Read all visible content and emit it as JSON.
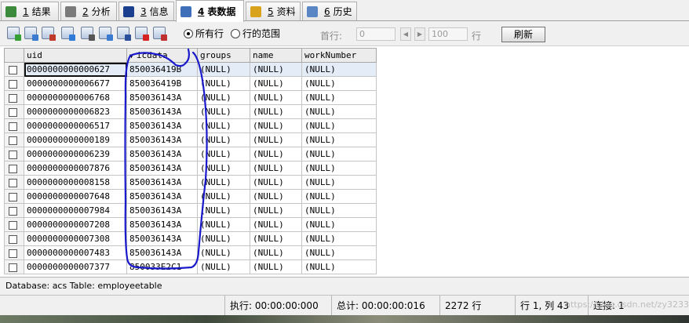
{
  "tabs": [
    {
      "num": "1",
      "label": "结果",
      "icon": "results-icon",
      "color": "#3c8a3c",
      "active": false
    },
    {
      "num": "2",
      "label": "分析",
      "icon": "profiler-icon",
      "color": "#7a7a7a",
      "active": false
    },
    {
      "num": "3",
      "label": "信息",
      "icon": "info-icon",
      "color": "#1a3f8f",
      "active": false
    },
    {
      "num": "4",
      "label": "表数据",
      "icon": "table-data-icon",
      "color": "#3f6fb8",
      "active": true
    },
    {
      "num": "5",
      "label": "资料",
      "icon": "info-chart-icon",
      "color": "#d8a21a",
      "active": false
    },
    {
      "num": "6",
      "label": "历史",
      "icon": "history-icon",
      "color": "#5b86c5",
      "active": false
    }
  ],
  "toolbar": {
    "buttons": [
      "add-row-icon",
      "duplicate-row-icon",
      "save-row-icon",
      "edit-row-icon",
      "filter-icon",
      "export-icon",
      "save-icon",
      "delete-row-icon",
      "cancel-changes-icon"
    ],
    "radio_all_rows": "所有行",
    "radio_row_range": "行的范围",
    "first_row_label": "首行:",
    "first_row_value": "0",
    "row_count_value": "100",
    "rows_unit": "行",
    "refresh_label": "刷新"
  },
  "grid": {
    "columns": [
      "uid",
      "icdata",
      "groups",
      "name",
      "workNumber"
    ],
    "sorted_column": "icdata",
    "rows": [
      [
        "0000000000000627",
        "850036419B",
        "(NULL)",
        "(NULL)",
        "(NULL)"
      ],
      [
        "0000000000006677",
        "850036419B",
        "(NULL)",
        "(NULL)",
        "(NULL)"
      ],
      [
        "0000000000006768",
        "850036143A",
        "(NULL)",
        "(NULL)",
        "(NULL)"
      ],
      [
        "0000000000006823",
        "850036143A",
        "(NULL)",
        "(NULL)",
        "(NULL)"
      ],
      [
        "0000000000006517",
        "850036143A",
        "(NULL)",
        "(NULL)",
        "(NULL)"
      ],
      [
        "0000000000000189",
        "850036143A",
        "(NULL)",
        "(NULL)",
        "(NULL)"
      ],
      [
        "0000000000006239",
        "850036143A",
        "(NULL)",
        "(NULL)",
        "(NULL)"
      ],
      [
        "0000000000007876",
        "850036143A",
        "(NULL)",
        "(NULL)",
        "(NULL)"
      ],
      [
        "0000000000008158",
        "850036143A",
        "(NULL)",
        "(NULL)",
        "(NULL)"
      ],
      [
        "0000000000007648",
        "850036143A",
        "(NULL)",
        "(NULL)",
        "(NULL)"
      ],
      [
        "0000000000007984",
        "850036143A",
        "(NULL)",
        "(NULL)",
        "(NULL)"
      ],
      [
        "0000000000007208",
        "850036143A",
        "(NULL)",
        "(NULL)",
        "(NULL)"
      ],
      [
        "0000000000007308",
        "850036143A",
        "(NULL)",
        "(NULL)",
        "(NULL)"
      ],
      [
        "0000000000007483",
        "850036143A",
        "(NULL)",
        "(NULL)",
        "(NULL)"
      ],
      [
        "0000000000007377",
        "850033E2C1",
        "(NULL)",
        "(NULL)",
        "(NULL)"
      ]
    ]
  },
  "footer": {
    "db_info": "Database: acs Table: employeetable"
  },
  "status": {
    "exec": "执行: 00:00:00:000",
    "total": "总计: 00:00:00:016",
    "count": "2272 行",
    "position": "行 1, 列 43",
    "selected": "连接: 1",
    "watermark": "https://blog.csdn.net/zy3233"
  },
  "annotation_color": "#1a1acc"
}
